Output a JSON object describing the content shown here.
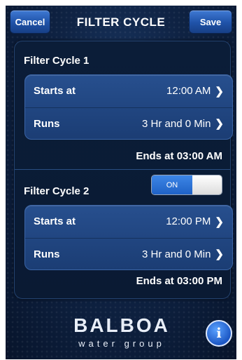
{
  "header": {
    "title": "FILTER CYCLE",
    "cancel_label": "Cancel",
    "save_label": "Save"
  },
  "filter_cycle_1": {
    "title": "Filter Cycle 1",
    "starts_label": "Starts at",
    "starts_value": "12:00 AM",
    "runs_label": "Runs",
    "runs_value": "3 Hr and 0 Min",
    "ends_text": "Ends at 03:00 AM"
  },
  "filter_cycle_2": {
    "title": "Filter Cycle 2",
    "toggle_label": "ON",
    "toggle_state": "on",
    "starts_label": "Starts at",
    "starts_value": "12:00 PM",
    "runs_label": "Runs",
    "runs_value": "3 Hr and 0 Min",
    "ends_text": "Ends at 03:00 PM"
  },
  "footer": {
    "logo_brand": "BALBOA",
    "logo_sub": "water group",
    "info_icon": "info-icon"
  },
  "chevron": "›"
}
